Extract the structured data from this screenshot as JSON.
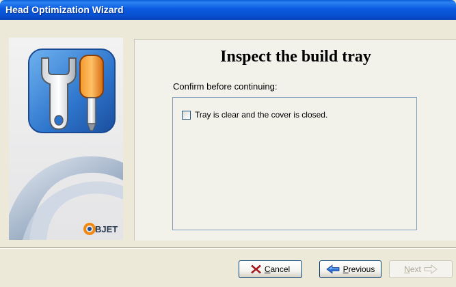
{
  "window": {
    "title": "Head Optimization Wizard"
  },
  "sidebar": {
    "logo_text": "BJET"
  },
  "content": {
    "heading": "Inspect the build tray",
    "instruction": "Confirm before continuing:",
    "checkbox": {
      "label": "Tray is clear and the cover is closed.",
      "checked": false
    }
  },
  "buttons": {
    "cancel": {
      "underline": "C",
      "rest": "ancel"
    },
    "previous": {
      "underline": "P",
      "rest": "revious"
    },
    "next": {
      "underline": "N",
      "rest": "ext",
      "enabled": false
    }
  },
  "colors": {
    "titlebar": "#0a5ae0",
    "window_bg": "#ece9d8",
    "cancel_icon": "#c4161c",
    "previous_icon": "#2f6fd6"
  }
}
